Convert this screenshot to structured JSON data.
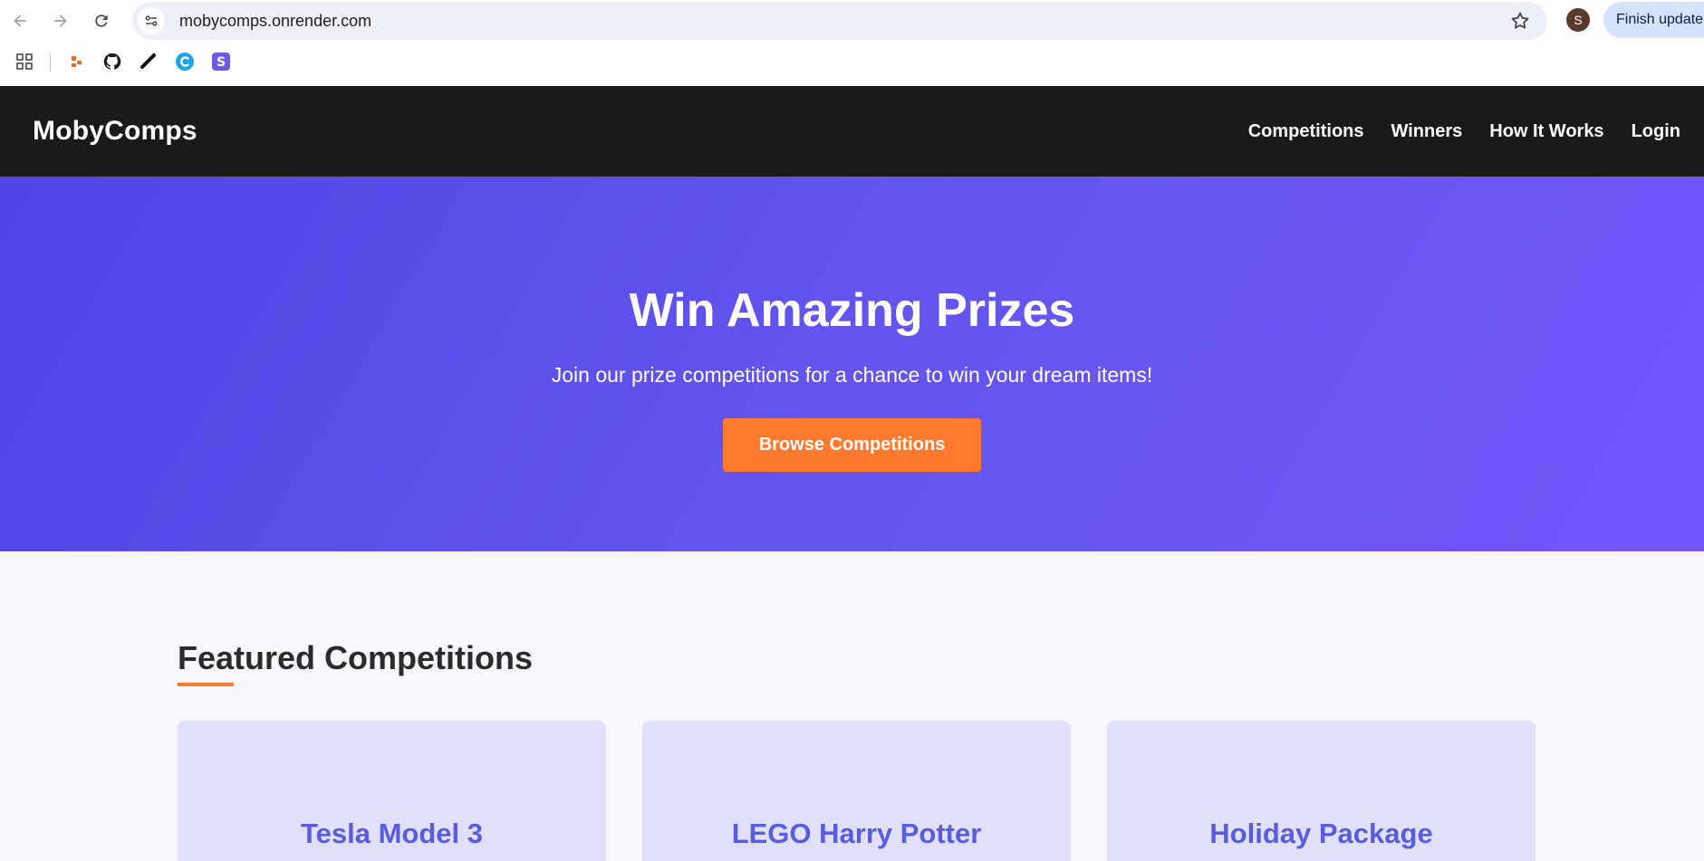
{
  "browser": {
    "url": "mobycomps.onrender.com",
    "avatar_letter": "S",
    "finish_update_label": "Finish update",
    "icons": [
      "back-arrow-icon",
      "forward-arrow-icon",
      "reload-icon",
      "site-info-icon",
      "star-icon",
      "apps-grid-icon"
    ],
    "bookmarks": [
      "orange-bookmark-icon",
      "github-icon",
      "black-logo-bookmark-icon",
      "blue-c-bookmark-icon",
      "s-bookmark-icon"
    ]
  },
  "header": {
    "logo": "MobyComps",
    "nav": [
      "Competitions",
      "Winners",
      "How It Works",
      "Login"
    ]
  },
  "hero": {
    "title": "Win Amazing Prizes",
    "subtitle": "Join our prize competitions for a chance to win your dream items!",
    "cta": "Browse Competitions"
  },
  "featured": {
    "title": "Featured Competitions",
    "cards": [
      "Tesla Model 3",
      "LEGO Harry Potter",
      "Holiday Package"
    ]
  },
  "colors": {
    "header_bg": "#1a1a1a",
    "hero_gradient_start": "#4f46e5",
    "hero_gradient_end": "#7357fb",
    "accent_orange": "#ff7a2f",
    "card_bg": "#e0e0fb",
    "card_title": "#5a5ce0"
  }
}
